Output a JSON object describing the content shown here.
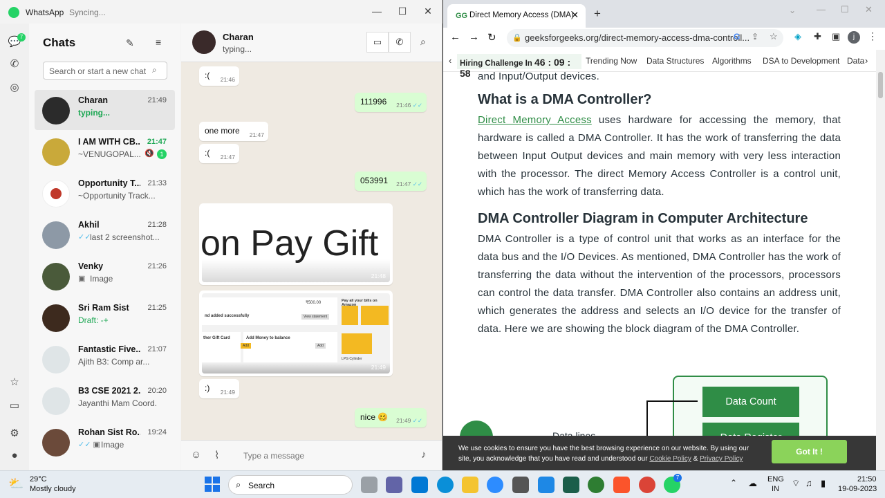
{
  "whatsapp": {
    "app_name": "WhatsApp",
    "status": "Syncing...",
    "rail_badge": "7",
    "chats_title": "Chats",
    "search_placeholder": "Search or start a new chat",
    "chats": [
      {
        "name": "Charan",
        "time": "21:49",
        "preview": "typing...",
        "preview_style": "green",
        "selected": true
      },
      {
        "name": "I AM WITH CB...",
        "time": "21:47",
        "preview": "~VENUGOPAL...",
        "unread": "1"
      },
      {
        "name": "Opportunity T...",
        "time": "21:33",
        "preview": "~Opportunity Track..."
      },
      {
        "name": "Akhil",
        "time": "21:28",
        "preview": "last 2 screenshot..."
      },
      {
        "name": "Venky",
        "time": "21:26",
        "preview": "Image"
      },
      {
        "name": "Sri Ram Sist",
        "time": "21:25",
        "preview": "Draft: -+",
        "preview_style": "green"
      },
      {
        "name": "Fantastic Five...",
        "time": "21:07",
        "preview": "Ajith B3: Comp ar..."
      },
      {
        "name": "B3 CSE 2021 2...",
        "time": "20:20",
        "preview": "Jayanthi Mam Coord..."
      },
      {
        "name": "Rohan Sist Ro...",
        "time": "19:24",
        "preview": "Image"
      }
    ],
    "conversation": {
      "contact": "Charan",
      "status": "typing...",
      "messages": [
        {
          "dir": "in",
          "text": ":(",
          "time": "21:46"
        },
        {
          "dir": "out",
          "text": "111996",
          "time": "21:46"
        },
        {
          "dir": "in",
          "text": "one more",
          "time": "21:47"
        },
        {
          "dir": "in",
          "text": ":(",
          "time": "21:47"
        },
        {
          "dir": "out",
          "text": "053991",
          "time": "21:47"
        },
        {
          "dir": "in",
          "text": "on Pay Gift",
          "time": "21:48",
          "kind": "image"
        },
        {
          "dir": "in",
          "text": "",
          "time": "21:49",
          "kind": "image"
        },
        {
          "dir": "in",
          "text": ":)",
          "time": "21:49"
        },
        {
          "dir": "out",
          "text": "nice 🥴",
          "time": "21:49"
        }
      ],
      "screenshot_texts": {
        "price": "₹500.00",
        "title": "Pay all your bills on Amazon",
        "added": "nd added successfully",
        "view": "View statement",
        "gift": "ther Gift Card",
        "money": "Add Money to balance",
        "add": "Add",
        "lpg": "LPG Cylinder"
      },
      "input_placeholder": "Type a message"
    }
  },
  "browser": {
    "tab_title": "Direct Memory Access (DMA) Co",
    "url": "geeksforgeeks.org/direct-memory-access-dma-controll...",
    "nav": {
      "hiring": "Hiring Challenge In",
      "timer": "46 : 09 : 58",
      "items": [
        "Trending Now",
        "Data Structures",
        "Algorithms",
        "DSA to Development",
        "Data"
      ]
    },
    "article": {
      "cut_text": "and Input/Output devices.",
      "h1": "What is a DMA Controller?",
      "p1_link": "Direct Memory Access",
      "p1_rest": " uses hardware for accessing the memory, that hardware is called a DMA Controller. It has the work of transferring the data between Input Output devices and main memory with very less interaction with the processor. The direct Memory Access Controller is a control unit, which has the work of transferring data.",
      "h2": "DMA Controller Diagram in Computer Architecture",
      "p2": "DMA Controller is a type of control unit that works as an interface for the data bus and the I/O Devices. As mentioned, DMA Controller has the work of transferring the data without the intervention of the processors, processors can control the data transfer. DMA Controller also contains an address unit, which generates the address and selects an I/O device for the transfer of data. Here we are showing the block diagram of the DMA Controller.",
      "diagram_box1": "Data Count",
      "diagram_box2": "Data Register",
      "diagram_label": "Data lines"
    },
    "cookie": {
      "text": "We use cookies to ensure you have the best browsing experience on our website. By using our site, you acknowledge that you have read and understood our",
      "cookie_policy": "Cookie Policy",
      "amp": "&",
      "privacy_policy": "Privacy Policy",
      "button": "Got It !"
    }
  },
  "taskbar": {
    "temp": "29°C",
    "weather": "Mostly cloudy",
    "search": "Search",
    "lang1": "ENG",
    "lang2": "IN",
    "time": "21:50",
    "date": "19-09-2023",
    "wa_badge": "7"
  }
}
